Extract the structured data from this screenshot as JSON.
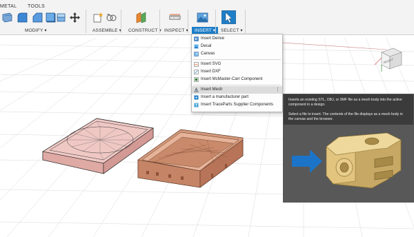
{
  "toolbar": {
    "tabs": [
      "METAL",
      "TOOLS"
    ],
    "groups": {
      "modify": "MODIFY ▾",
      "assemble": "ASSEMBLE ▾",
      "construct": "CONSTRUCT ▾",
      "inspect": "INSPECT ▾",
      "insert": "INSERT ▾",
      "select": "SELECT ▾"
    }
  },
  "insert_menu": {
    "items": [
      {
        "label": "Insert Derive",
        "icon": "derive-icon"
      },
      {
        "label": "Decal",
        "icon": "decal-icon"
      },
      {
        "label": "Canvas",
        "icon": "canvas-icon"
      },
      {
        "label": "Insert SVG",
        "icon": "svg-icon"
      },
      {
        "label": "Insert DXF",
        "icon": "dxf-icon"
      },
      {
        "label": "Insert McMaster-Carr Component",
        "icon": "mcmaster-icon"
      },
      {
        "label": "Insert Mesh",
        "icon": "mesh-icon",
        "highlighted": true
      },
      {
        "label": "Insert a manufacturer part",
        "icon": "manufacturer-part-icon"
      },
      {
        "label": "Insert TraceParts Supplier Components",
        "icon": "traceparts-icon"
      }
    ]
  },
  "tooltip": {
    "line1": "Inserts an existing STL, OBJ, or 3MF file as a mesh body into the active component in a design.",
    "line2": "Select a file to insert. The contents of the file displays as a mesh body in the canvas and the browser."
  },
  "viewcube": {
    "face_label": "RIGHT"
  },
  "colors": {
    "accent": "#1e7ec8",
    "mesh_pink": "#e9bcb8",
    "mesh_copper": "#d49a7c",
    "tooltip_bg": "#3b3b3b",
    "preview_part": "#e9cf8e",
    "preview_arrow": "#1c74c8"
  }
}
